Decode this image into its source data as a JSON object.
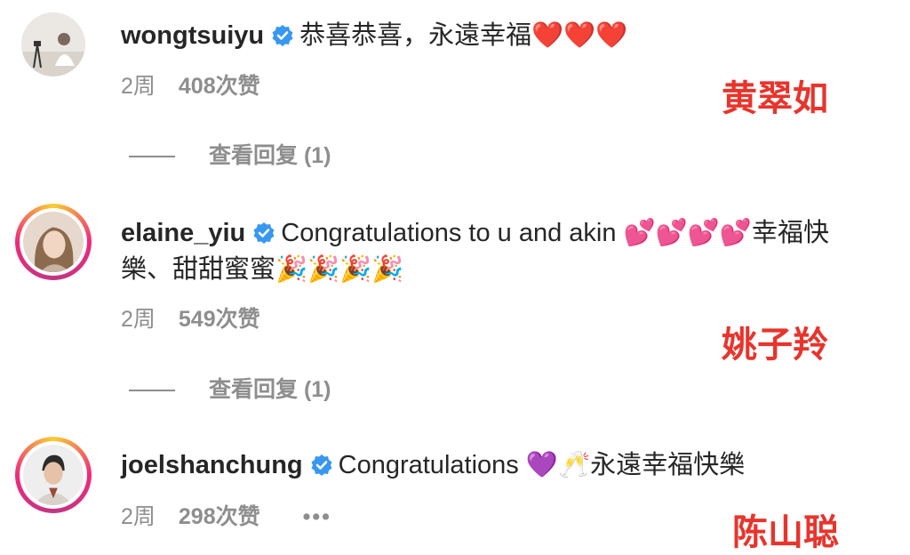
{
  "comments": [
    {
      "username": "wongtsuiyu",
      "text": "恭喜恭喜，永遠幸福",
      "emojis": "❤️❤️❤️",
      "time": "2周",
      "likes": "408次赞",
      "replies": "查看回复 (1)",
      "annotation": "黄翠如"
    },
    {
      "username": "elaine_yiu",
      "text": "Congratulations to u and akin",
      "emojis": "💕💕💕💕",
      "text2": "幸福快",
      "text3": "樂、甜甜蜜蜜",
      "emojis2": "🎉🎉🎉🎉",
      "time": "2周",
      "likes": "549次赞",
      "replies": "查看回复 (1)",
      "annotation": "姚子羚"
    },
    {
      "username": "joelshanchung",
      "text": "Congratulations",
      "emojis": "💜🥂",
      "text2": "永遠幸福快樂",
      "time": "2周",
      "likes": "298次赞",
      "more": "•••",
      "annotation": "陈山聪"
    }
  ],
  "colors": {
    "verified": "#3897f0",
    "annotation": "#e8342c",
    "meta": "#8e8e8e"
  }
}
